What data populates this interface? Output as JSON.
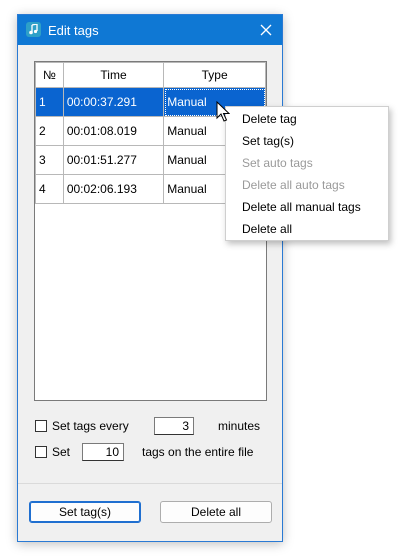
{
  "window": {
    "title": "Edit tags",
    "close_symbol": "✕"
  },
  "table": {
    "columns": [
      "№",
      "Time",
      "Type"
    ],
    "rows": [
      {
        "no": "1",
        "time": "00:00:37.291",
        "type": "Manual"
      },
      {
        "no": "2",
        "time": "00:01:08.019",
        "type": "Manual"
      },
      {
        "no": "3",
        "time": "00:01:51.277",
        "type": "Manual"
      },
      {
        "no": "4",
        "time": "00:02:06.193",
        "type": "Manual"
      }
    ],
    "selected_row": 1
  },
  "options": {
    "interval": {
      "label": "Set tags every",
      "value": "3",
      "unit": "minutes",
      "checked": false
    },
    "count": {
      "label": "Set",
      "value": "10",
      "suffix": "tags on the entire file",
      "checked": false
    }
  },
  "buttons": {
    "set_tags": "Set tag(s)",
    "delete_all": "Delete all"
  },
  "context_menu": {
    "items": [
      {
        "label": "Delete tag",
        "enabled": true
      },
      {
        "label": "Set tag(s)",
        "enabled": true
      },
      {
        "label": "Set auto tags",
        "enabled": false
      },
      {
        "label": "Delete all auto tags",
        "enabled": false
      },
      {
        "label": "Delete all manual tags",
        "enabled": true
      },
      {
        "label": "Delete all",
        "enabled": true
      }
    ]
  },
  "colors": {
    "titlebar": "#0f78d4",
    "selection": "#0a64d0",
    "disabled_text": "#9a9a9a"
  },
  "icons": {
    "app": "music-note-icon",
    "close": "close-icon",
    "cursor": "mouse-pointer-icon"
  }
}
